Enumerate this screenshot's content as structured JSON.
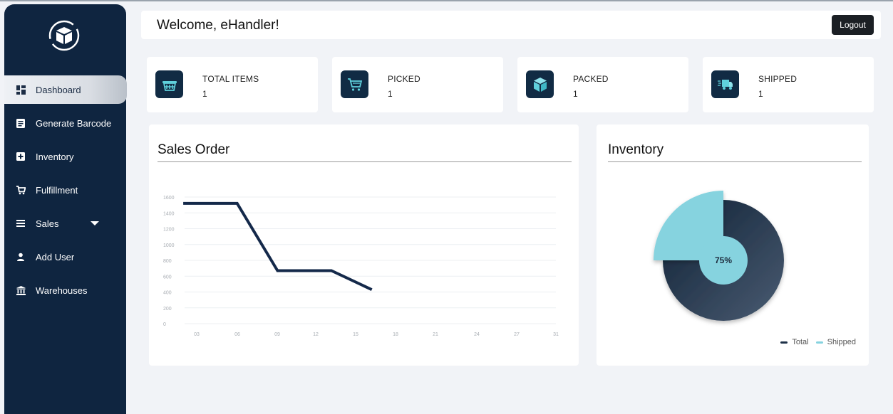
{
  "sidebar": {
    "logo_icon": "box-cycle-icon",
    "items": [
      {
        "label": "Dashboard",
        "icon": "dashboard-icon"
      },
      {
        "label": "Generate Barcode",
        "icon": "document-icon"
      },
      {
        "label": "Inventory",
        "icon": "plus-box-icon"
      },
      {
        "label": "Fulfillment",
        "icon": "cart-icon"
      },
      {
        "label": "Sales",
        "icon": "list-icon"
      },
      {
        "label": "Add User",
        "icon": "user-icon"
      },
      {
        "label": "Warehouses",
        "icon": "bank-icon"
      }
    ]
  },
  "header": {
    "welcome": "Welcome, eHandler!",
    "logout_label": "Logout"
  },
  "stats": [
    {
      "label": "TOTAL ITEMS",
      "value": "1",
      "icon": "basket-icon"
    },
    {
      "label": "PICKED",
      "value": "1",
      "icon": "cart-icon"
    },
    {
      "label": "PACKED",
      "value": "1",
      "icon": "package-icon"
    },
    {
      "label": "SHIPPED",
      "value": "1",
      "icon": "truck-icon"
    }
  ],
  "sales_panel": {
    "title": "Sales Order"
  },
  "inventory_panel": {
    "title": "Inventory"
  },
  "colors": {
    "sidebar": "#0f2540",
    "icon_bg": "#112b44",
    "line": "#14294a",
    "total": "#1e3148",
    "shipped": "#86d3df"
  },
  "chart_data": [
    {
      "type": "line",
      "title": "",
      "x": [
        "03",
        "06",
        "09",
        "12",
        "15",
        "18",
        "21",
        "24",
        "27",
        "31"
      ],
      "yticks": [
        0,
        200,
        400,
        600,
        800,
        1000,
        1200,
        1400,
        1600
      ],
      "ylim": [
        0,
        1600
      ],
      "grid": true,
      "series": [
        {
          "points": [
            [
              2,
              1520
            ],
            [
              6,
              1520
            ],
            [
              9,
              670
            ],
            [
              13,
              670
            ],
            [
              16,
              430
            ]
          ]
        }
      ]
    },
    {
      "type": "pie",
      "title": "",
      "slices": [
        {
          "label": "Total",
          "value": 75
        },
        {
          "label": "Shipped",
          "value": 25
        }
      ],
      "center_label": "75%",
      "legend": "bottom-right"
    }
  ]
}
